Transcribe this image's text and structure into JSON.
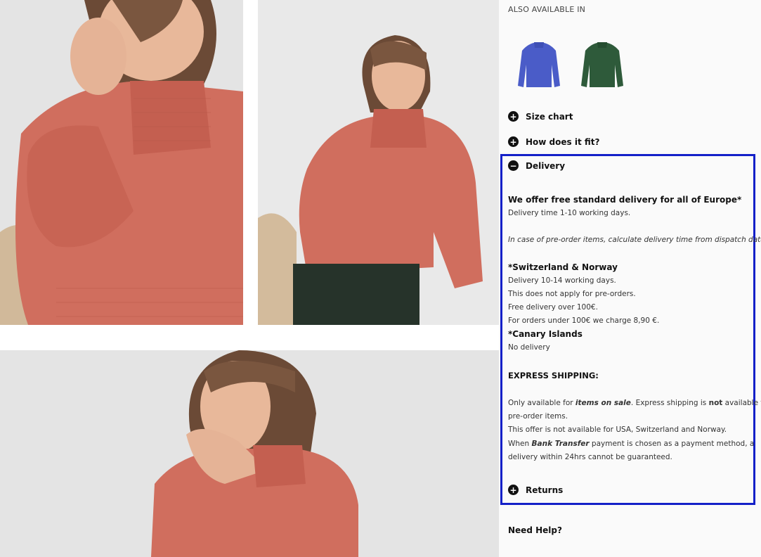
{
  "also_available": {
    "label": "ALSO AVAILABLE IN",
    "swatches": [
      {
        "name": "blue-sweater",
        "color": "#4a5cc8"
      },
      {
        "name": "green-sweater",
        "color": "#2e5a3a"
      }
    ]
  },
  "accordion": {
    "size_chart": {
      "icon": "+",
      "label": "Size chart"
    },
    "fit": {
      "icon": "+",
      "label": "How does it fit?"
    },
    "delivery": {
      "icon": "−",
      "label": "Delivery"
    },
    "returns": {
      "icon": "+",
      "label": "Returns"
    }
  },
  "delivery_content": {
    "free_headline": "We offer free standard delivery for all of Europe*",
    "delivery_time": "Delivery time 1-10 working days.",
    "preorder_note": "In case of pre-order items, calculate delivery time from dispatch date.",
    "swiss_norway_title": "*Switzerland & Norway",
    "swiss_norway_lines": [
      "Delivery 10-14 working days.",
      "This does not apply for pre-orders.",
      "Free delivery over 100€.",
      "For orders under 100€ we charge 8,90 €."
    ],
    "canary_title": "*Canary Islands",
    "canary_line": "No delivery",
    "express_title": "EXPRESS SHIPPING:",
    "express_p1_a": "Only available for ",
    "express_p1_b": "items on sale",
    "express_p1_c": ". Express shipping is ",
    "express_p1_d": "not",
    "express_p1_e": " available for",
    "express_p1_line2": "pre-order items.",
    "express_p2": "This offer is not available for USA, Switzerland and Norway.",
    "express_p3_a": "When ",
    "express_p3_b": "Bank Transfer",
    "express_p3_c": " payment is chosen as a payment method, a",
    "express_p3_line2": "delivery within 24hrs cannot be guaranteed."
  },
  "need_help": "Need Help?",
  "colors": {
    "highlight": "#1420c8",
    "sweater": "#d06e5e",
    "background": "#e6e6e6"
  }
}
